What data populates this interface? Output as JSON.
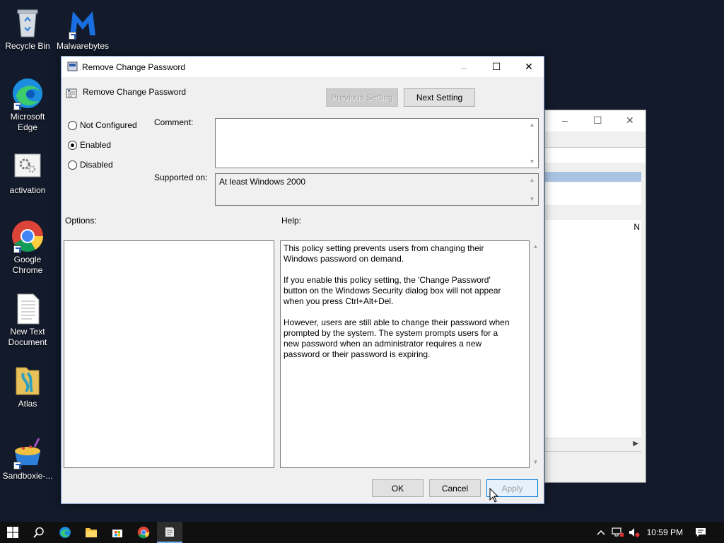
{
  "desktop": {
    "icons": [
      {
        "label": "Recycle Bin",
        "icon": "recycle-bin-icon"
      },
      {
        "label": "Malwarebytes",
        "icon": "malwarebytes-icon"
      },
      {
        "label": "Microsoft Edge",
        "icon": "edge-icon"
      },
      {
        "label": "activation",
        "icon": "gear-icon"
      },
      {
        "label": "Google Chrome",
        "icon": "chrome-icon"
      },
      {
        "label": "New Text Document",
        "icon": "text-document-icon"
      },
      {
        "label": "Atlas",
        "icon": "atlas-icon"
      },
      {
        "label": "Sandboxie-...",
        "icon": "sandboxie-icon"
      }
    ]
  },
  "background_window": {
    "column_char": "N"
  },
  "dialog": {
    "title": "Remove Change Password",
    "setting_name": "Remove Change Password",
    "prev_button": "Previous Setting",
    "next_button": "Next Setting",
    "radios": [
      {
        "label": "Not Configured",
        "checked": false
      },
      {
        "label": "Enabled",
        "checked": true
      },
      {
        "label": "Disabled",
        "checked": false
      }
    ],
    "comment_label": "Comment:",
    "comment_value": "",
    "supported_label": "Supported on:",
    "supported_value": "At least Windows 2000",
    "options_label": "Options:",
    "help_label": "Help:",
    "help_paragraphs": [
      "This policy setting prevents users from changing their Windows password on demand.",
      "If you enable this policy setting,  the 'Change Password' button on the Windows Security dialog box will not appear when you press Ctrl+Alt+Del.",
      "However, users are still able to change their password when prompted by the system. The system prompts users for a new password when an administrator requires a new password or their password is expiring."
    ],
    "ok_button": "OK",
    "cancel_button": "Cancel",
    "apply_button": "Apply"
  },
  "taskbar": {
    "items": [
      "start-icon",
      "search-icon",
      "edge-icon",
      "file-explorer-icon",
      "store-icon",
      "chrome-icon",
      "notepad-icon"
    ],
    "clock": "10:59 PM"
  },
  "colors": {
    "desktop": "#121a2b",
    "accent": "#0078d7",
    "selection": "#a9c4e3"
  }
}
